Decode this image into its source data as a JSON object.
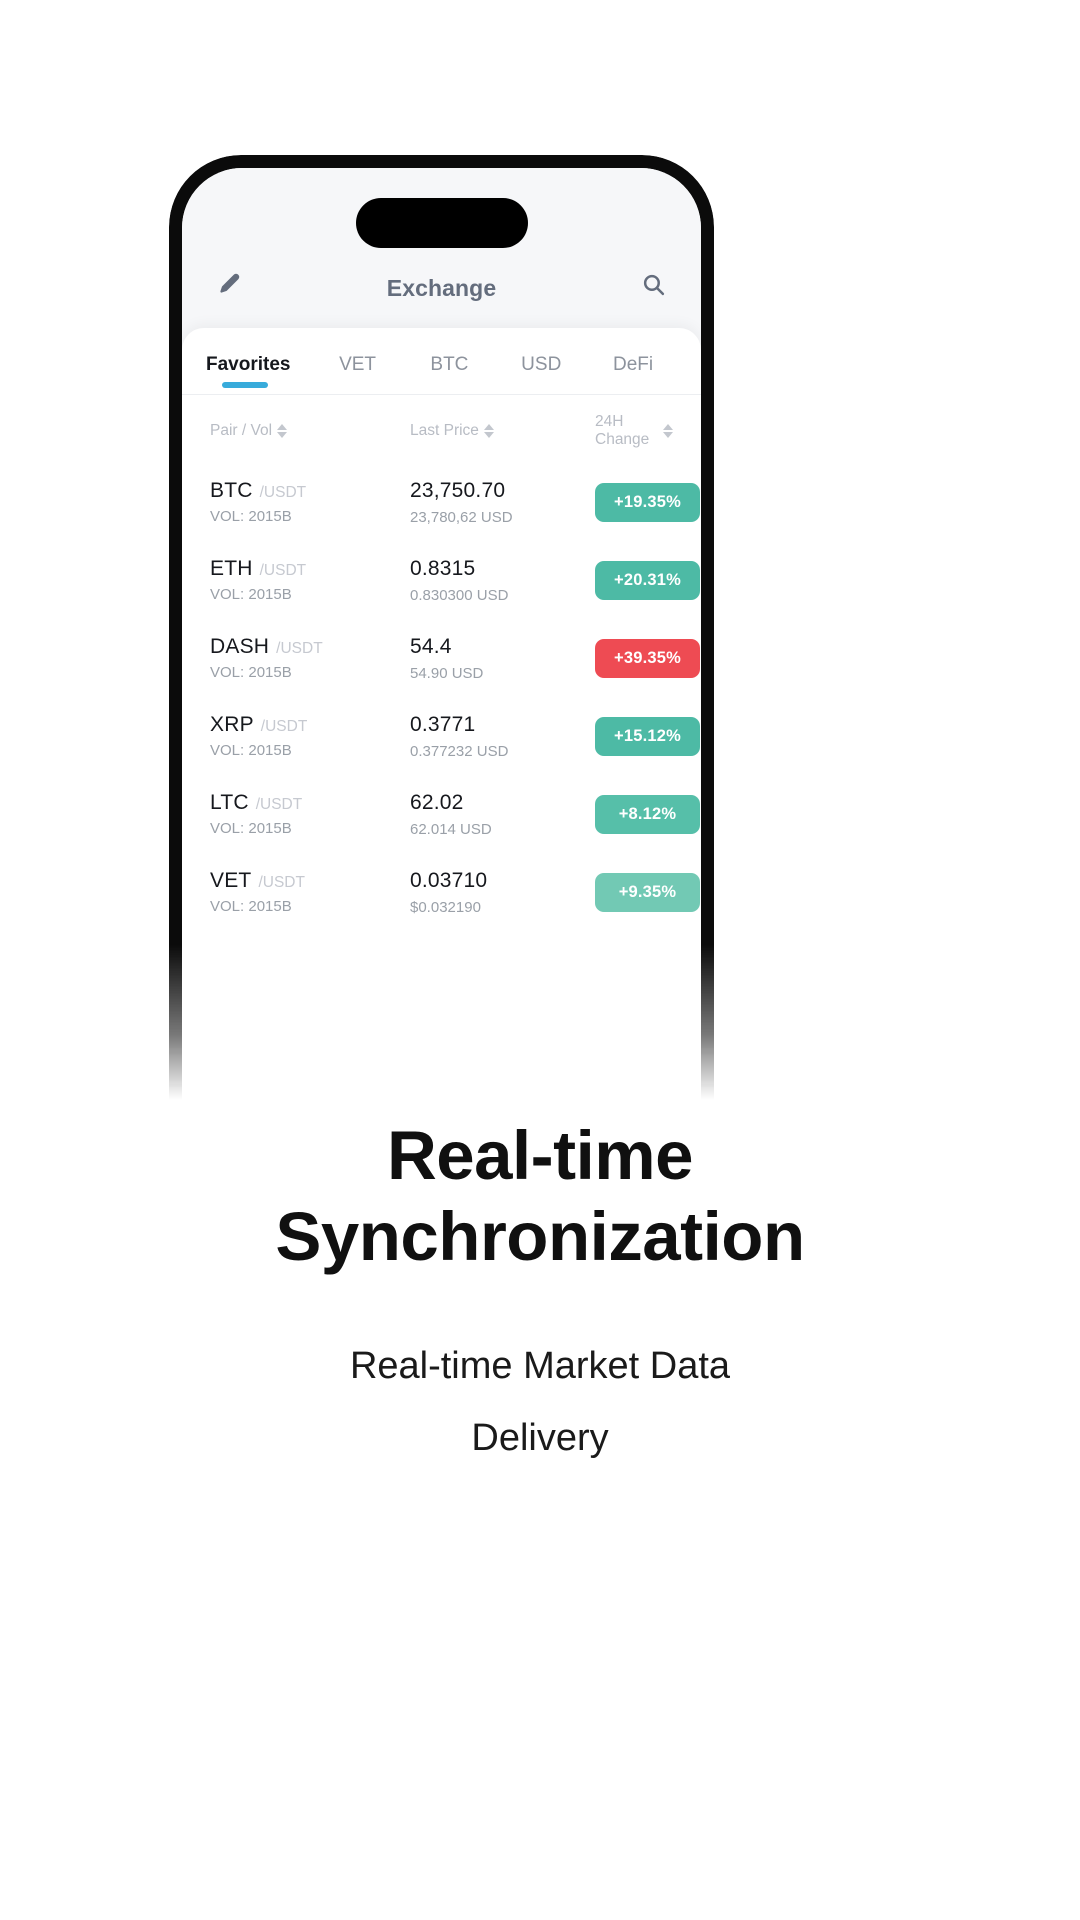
{
  "phone": {
    "header": {
      "edit_icon": "pencil-icon",
      "title": "Exchange",
      "search_icon": "search-icon"
    },
    "tabs": [
      {
        "label": "Favorites",
        "active": true
      },
      {
        "label": "VET",
        "active": false
      },
      {
        "label": "BTC",
        "active": false
      },
      {
        "label": "USD",
        "active": false
      },
      {
        "label": "DeFi",
        "active": false
      }
    ],
    "columns": {
      "pair": "Pair / Vol",
      "price": "Last Price",
      "change": "24H Change"
    },
    "rows": [
      {
        "symbol": "BTC",
        "quote": "/USDT",
        "volume": "VOL: 2015B",
        "price": "23,750.70",
        "price_sub": "23,780,62 USD",
        "change": "+19.35%",
        "change_color": "#4dbaa5"
      },
      {
        "symbol": "ETH",
        "quote": "/USDT",
        "volume": "VOL: 2015B",
        "price": "0.8315",
        "price_sub": "0.830300 USD",
        "change": "+20.31%",
        "change_color": "#4dbaa5"
      },
      {
        "symbol": "DASH",
        "quote": "/USDT",
        "volume": "VOL: 2015B",
        "price": "54.4",
        "price_sub": "54.90 USD",
        "change": "+39.35%",
        "change_color": "#ee4b53"
      },
      {
        "symbol": "XRP",
        "quote": "/USDT",
        "volume": "VOL: 2015B",
        "price": "0.3771",
        "price_sub": "0.377232 USD",
        "change": "+15.12%",
        "change_color": "#4dbaa5"
      },
      {
        "symbol": "LTC",
        "quote": "/USDT",
        "volume": "VOL: 2015B",
        "price": "62.02",
        "price_sub": "62.014 USD",
        "change": "+8.12%",
        "change_color": "#56bfa9"
      },
      {
        "symbol": "VET",
        "quote": "/USDT",
        "volume": "VOL: 2015B",
        "price": "0.03710",
        "price_sub": "$0.032190",
        "change": "+9.35%",
        "change_color": "#72c9b4"
      }
    ]
  },
  "caption": {
    "title_line1": "Real-time",
    "title_line2": "Synchronization",
    "subtitle_line1": "Real-time Market Data",
    "subtitle_line2": "Delivery"
  },
  "theme": {
    "accent_blue": "#38abdb",
    "positive": "#4dbaa5",
    "negative": "#ee4b53",
    "text_dark": "#16181d",
    "text_muted": "#9aa0a8"
  }
}
